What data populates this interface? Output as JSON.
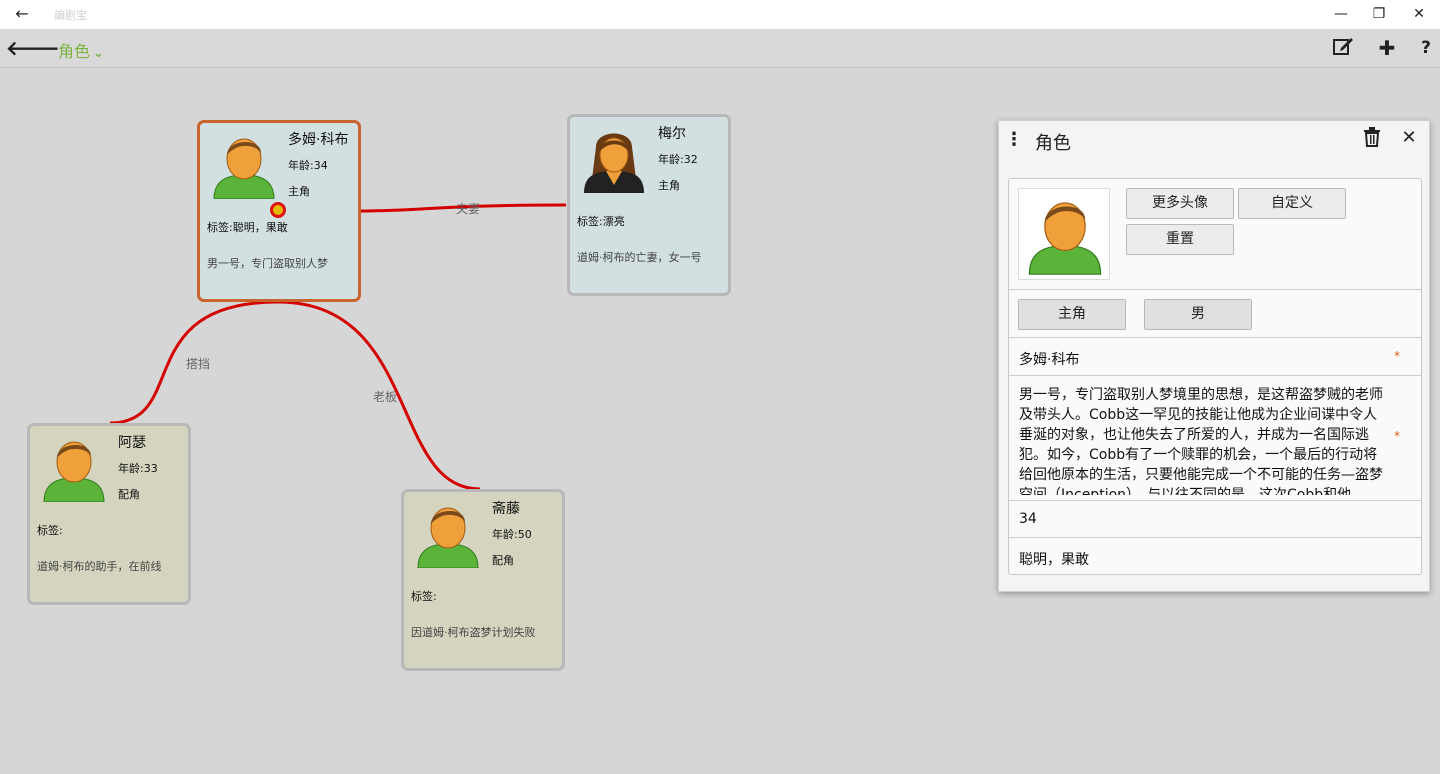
{
  "titlebar": {
    "title": "编剧宝"
  },
  "toolbar": {
    "mode_label": "角色"
  },
  "links": [
    {
      "label": "夫妻"
    },
    {
      "label": "搭挡"
    },
    {
      "label": "老板"
    }
  ],
  "cards": [
    {
      "name": "多姆·科布",
      "age": "年龄:34",
      "role": "主角",
      "tags": "标签:聪明，果敢",
      "desc": "男一号，专门盗取别人梦"
    },
    {
      "name": "梅尔",
      "age": "年龄:32",
      "role": "主角",
      "tags": "标签:漂亮",
      "desc": "道姆·柯布的亡妻，女一号"
    },
    {
      "name": "阿瑟",
      "age": "年龄:33",
      "role": "配角",
      "tags": "标签:",
      "desc": "道姆·柯布的助手，在前线"
    },
    {
      "name": "斋藤",
      "age": "年龄:50",
      "role": "配角",
      "tags": "标签:",
      "desc": "因道姆·柯布盗梦计划失败"
    }
  ],
  "panel": {
    "title": "角色",
    "btn_more_avatars": "更多头像",
    "btn_custom": "自定义",
    "btn_reset": "重置",
    "role_value": "主角",
    "gender_value": "男",
    "name_value": "多姆·科布",
    "required_mark": "*",
    "description": "男一号，专门盗取别人梦境里的思想，是这帮盗梦贼的老师及带头人。Cobb这一罕见的技能让他成为企业间谍中令人垂涎的对象，也让他失去了所爱的人，并成为一名国际逃犯。如今，Cobb有了一个赎罪的机会，一个最后的行动将给回他原本的生活，只要他能完成一个不可能的任务—盗梦空间（Inception）。与以往不同的是，这次Cobb和他",
    "age_value": "34",
    "tags_value": "聪明，果敢"
  }
}
